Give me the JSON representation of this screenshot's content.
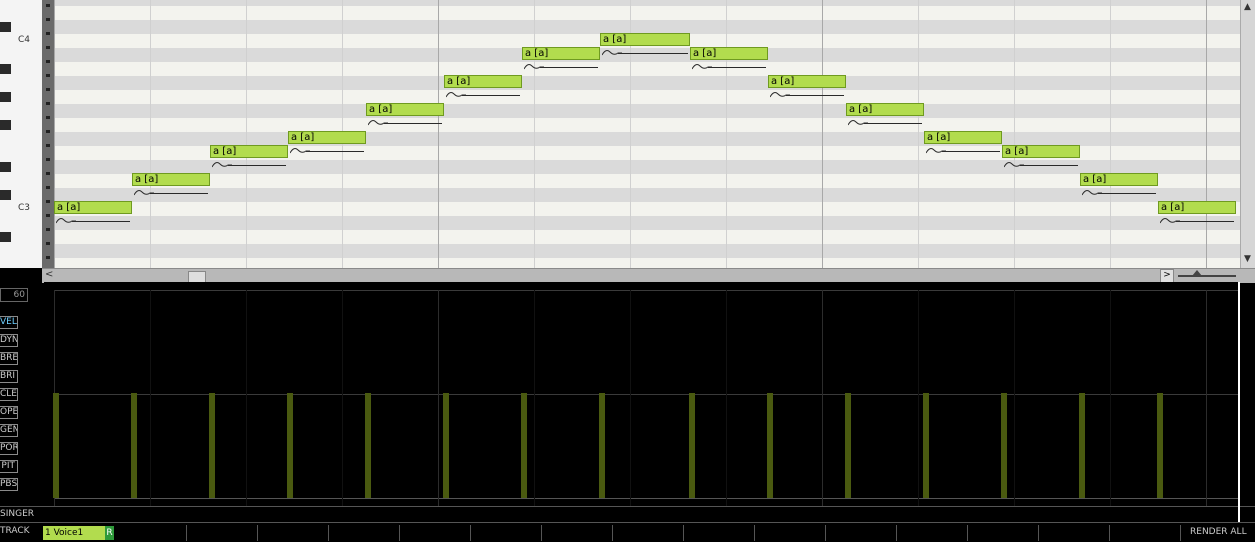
{
  "keyboard": {
    "labels": [
      {
        "text": "C4",
        "row": 2
      },
      {
        "text": "C3",
        "row": 14
      }
    ],
    "black_key_rows": [
      1,
      4,
      6,
      8,
      11,
      13,
      16
    ]
  },
  "notes": [
    {
      "lyric": "a [a]",
      "start": 0,
      "length": 78,
      "row": 14
    },
    {
      "lyric": "a [a]",
      "start": 78,
      "length": 78,
      "row": 12
    },
    {
      "lyric": "a [a]",
      "start": 156,
      "length": 78,
      "row": 10
    },
    {
      "lyric": "a [a]",
      "start": 234,
      "length": 78,
      "row": 9
    },
    {
      "lyric": "a [a]",
      "start": 312,
      "length": 78,
      "row": 7
    },
    {
      "lyric": "a [a]",
      "start": 390,
      "length": 78,
      "row": 5
    },
    {
      "lyric": "a [a]",
      "start": 468,
      "length": 78,
      "row": 3
    },
    {
      "lyric": "a [a]",
      "start": 546,
      "length": 90,
      "row": 2
    },
    {
      "lyric": "a [a]",
      "start": 636,
      "length": 78,
      "row": 3
    },
    {
      "lyric": "a [a]",
      "start": 714,
      "length": 78,
      "row": 5
    },
    {
      "lyric": "a [a]",
      "start": 792,
      "length": 78,
      "row": 7
    },
    {
      "lyric": "a [a]",
      "start": 870,
      "length": 78,
      "row": 9
    },
    {
      "lyric": "a [a]",
      "start": 948,
      "length": 78,
      "row": 10
    },
    {
      "lyric": "a [a]",
      "start": 1026,
      "length": 78,
      "row": 12
    },
    {
      "lyric": "a [a]",
      "start": 1104,
      "length": 78,
      "row": 14
    }
  ],
  "parameters": {
    "value": "60",
    "buttons": [
      {
        "label": "VEL",
        "active": true
      },
      {
        "label": "DYN",
        "active": false
      },
      {
        "label": "BRE",
        "active": false
      },
      {
        "label": "BRI",
        "active": false
      },
      {
        "label": "CLE",
        "active": false
      },
      {
        "label": "OPE",
        "active": false
      },
      {
        "label": "GEN",
        "active": false
      },
      {
        "label": "POR",
        "active": false
      },
      {
        "label": "PIT",
        "active": false
      },
      {
        "label": "PBS",
        "active": false
      }
    ],
    "velocity": 64,
    "velocity_max": 127
  },
  "singer_label": "SINGER",
  "track": {
    "label": "TRACK",
    "tab": "1 Voice1",
    "r_badge": "R",
    "render_all": "RENDER ALL"
  },
  "colors": {
    "note_fill": "#b2dc4e",
    "param_bar": "#4a5a10",
    "track_r": "#2e9a3a"
  }
}
